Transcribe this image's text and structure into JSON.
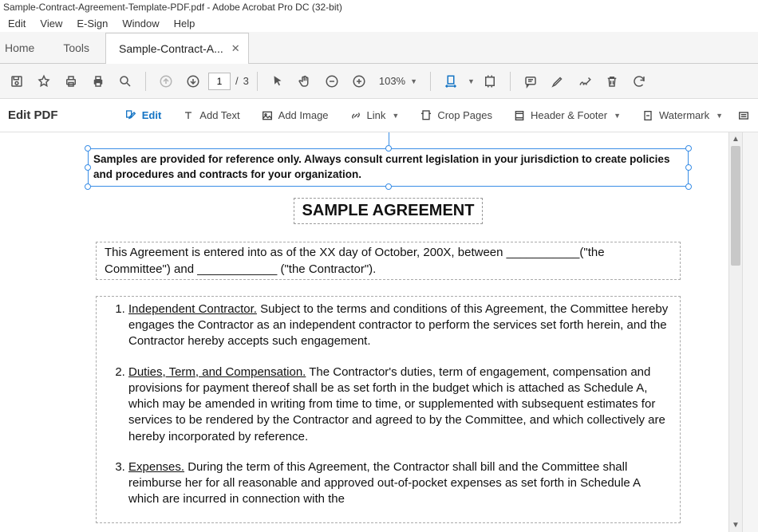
{
  "window": {
    "title": "Sample-Contract-Agreement-Template-PDF.pdf - Adobe Acrobat Pro DC (32-bit)"
  },
  "menu": {
    "edit": "Edit",
    "view": "View",
    "esign": "E-Sign",
    "window": "Window",
    "help": "Help"
  },
  "tabs": {
    "home": "Home",
    "tools": "Tools",
    "doc": "Sample-Contract-A..."
  },
  "toolbar": {
    "page_current": "1",
    "page_sep": "/",
    "page_total": "3",
    "zoom": "103%"
  },
  "edit_bar": {
    "title": "Edit PDF",
    "edit": "Edit",
    "add_text": "Add Text",
    "add_image": "Add Image",
    "link": "Link",
    "crop": "Crop Pages",
    "header_footer": "Header & Footer",
    "watermark": "Watermark"
  },
  "document": {
    "notice": "Samples are provided for reference only.  Always consult current legislation in your jurisdiction to create policies and procedures and contracts for your organization.",
    "title": "SAMPLE AGREEMENT",
    "intro": "This Agreement is entered into as of the XX day of October, 200X, between ___________(\"the Committee\") and ____________ (\"the Contractor\").",
    "item1_head": "Independent Contractor.",
    "item1_body": "  Subject to the terms and conditions of this Agreement, the Committee hereby engages the Contractor as an independent contractor to perform the services set forth herein, and the Contractor hereby accepts such engagement.",
    "item2_head": "Duties, Term, and Compensation.",
    "item2_body": "  The Contractor's duties, term of engagement, compensation and provisions for payment thereof shall be as set forth in the budget which is attached as Schedule A, which may be amended in writing from time to time, or supplemented with subsequent estimates for services to be rendered by the Contractor and agreed to by the Committee, and which collectively are hereby incorporated by reference.",
    "item3_head": "Expenses.",
    "item3_body": "  During the term of this Agreement, the Contractor shall bill and the Committee shall reimburse her for all reasonable and approved out-of-pocket expenses as set forth in Schedule A which are incurred in connection with the"
  }
}
